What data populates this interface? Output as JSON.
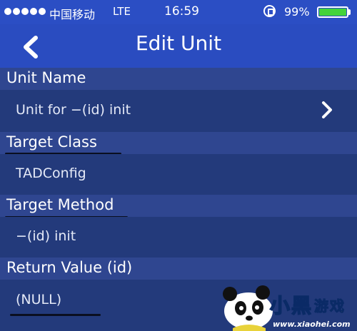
{
  "status_bar": {
    "carrier": "中国移动",
    "network": "LTE",
    "time": "16:59",
    "battery_percent": "99%",
    "battery_level": 0.99
  },
  "nav": {
    "title": "Edit Unit",
    "back_icon": "chevron-left-icon"
  },
  "sections": [
    {
      "header": "Unit Name",
      "value": "Unit for −(id) init",
      "has_disclosure": true
    },
    {
      "header": "Target Class",
      "value": "TADConfig"
    },
    {
      "header": "Target Method",
      "value": "−(id) init"
    },
    {
      "header": "Return Value (id)",
      "value": "(NULL)"
    }
  ],
  "watermark": {
    "logo_text": "小黑游戏",
    "url": "www.xiaohei.com"
  },
  "colors": {
    "accent": "#2a4cc0",
    "header_bg": "#2f4690",
    "value_bg": "#233a7b",
    "battery": "#43d33a"
  }
}
